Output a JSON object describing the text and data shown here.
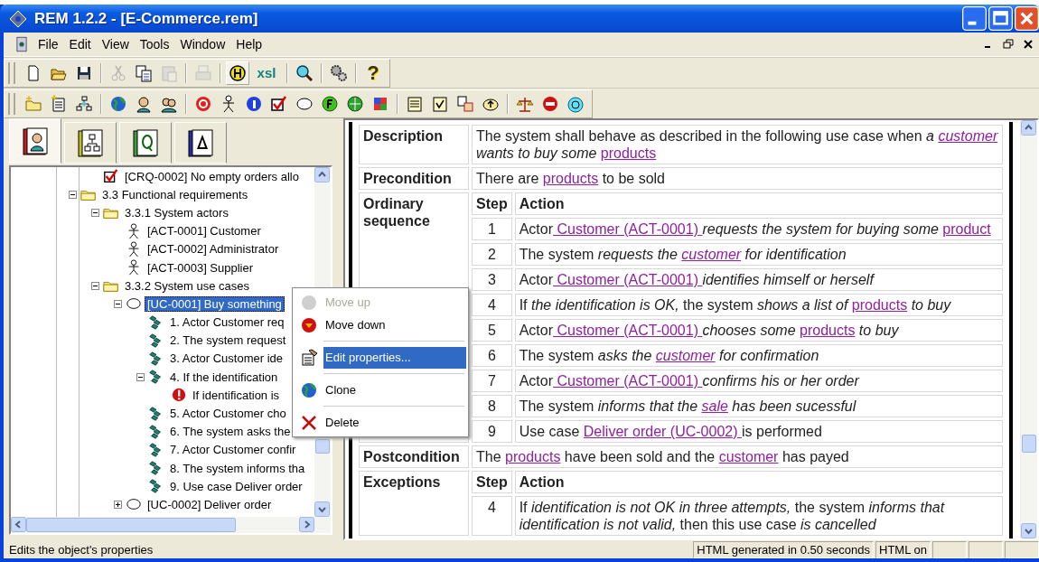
{
  "window": {
    "title": "REM 1.2.2 - [E-Commerce.rem]"
  },
  "menu": [
    "File",
    "Edit",
    "View",
    "Tools",
    "Window",
    "Help"
  ],
  "toolbars": [
    {
      "items": [
        {
          "kind": "new",
          "disabled": false
        },
        {
          "kind": "open",
          "disabled": false
        },
        {
          "kind": "save",
          "disabled": false
        },
        {
          "kind": "separator"
        },
        {
          "kind": "cut",
          "disabled": true
        },
        {
          "kind": "copy",
          "disabled": false
        },
        {
          "kind": "paste",
          "disabled": true
        },
        {
          "kind": "separator"
        },
        {
          "kind": "print",
          "disabled": true
        },
        {
          "kind": "separator"
        },
        {
          "kind": "html",
          "disabled": false
        },
        {
          "kind": "text",
          "label": "xsl",
          "disabled": false
        },
        {
          "kind": "separator"
        },
        {
          "kind": "zoom",
          "disabled": false
        },
        {
          "kind": "separator"
        },
        {
          "kind": "gears",
          "disabled": false
        },
        {
          "kind": "separator"
        },
        {
          "kind": "help",
          "label": "?",
          "disabled": false
        }
      ]
    },
    {
      "items": [
        {
          "kind": "new-folder"
        },
        {
          "kind": "new-doc"
        },
        {
          "kind": "diagram"
        },
        {
          "kind": "separator"
        },
        {
          "kind": "globe"
        },
        {
          "kind": "person"
        },
        {
          "kind": "people"
        },
        {
          "kind": "separator"
        },
        {
          "kind": "target"
        },
        {
          "kind": "actor"
        },
        {
          "kind": "info"
        },
        {
          "kind": "check"
        },
        {
          "kind": "ellipse"
        },
        {
          "kind": "green-ball"
        },
        {
          "kind": "green-globe"
        },
        {
          "kind": "grid"
        },
        {
          "kind": "separator"
        },
        {
          "kind": "note"
        },
        {
          "kind": "note-check"
        },
        {
          "kind": "docs"
        },
        {
          "kind": "oval-arrow"
        },
        {
          "kind": "separator"
        },
        {
          "kind": "scales"
        },
        {
          "kind": "stop"
        },
        {
          "kind": "cyan-ball"
        }
      ]
    }
  ],
  "tabs": [
    {
      "kind": "people-book",
      "selected": true
    },
    {
      "kind": "diagram-book",
      "selected": false
    },
    {
      "kind": "q-book",
      "selected": false
    },
    {
      "kind": "delta-book",
      "selected": false
    }
  ],
  "tree": {
    "items": [
      {
        "children": [
          {
            "label": "[CRQ-0002] No empty orders allo",
            "kind": "check",
            "selected": false
          }
        ]
      },
      {
        "label": "3.3 Functional requirements",
        "kind": "folder",
        "expanded": true,
        "selected": false,
        "children": [
          {
            "label": "3.3.1 System actors",
            "kind": "folder",
            "expanded": true,
            "selected": false,
            "children": [
              {
                "label": "[ACT-0001] Customer",
                "kind": "actor",
                "selected": false
              },
              {
                "label": "[ACT-0002] Administrator",
                "kind": "actor",
                "selected": false
              },
              {
                "label": "[ACT-0003] Supplier",
                "kind": "actor",
                "selected": false
              }
            ]
          },
          {
            "label": "3.3.2 System use cases",
            "kind": "folder",
            "expanded": true,
            "selected": false,
            "children": [
              {
                "label": "[UC-0001] Buy something",
                "kind": "ellipse",
                "expanded": true,
                "selected": true,
                "children": [
                  {
                    "label": "1. Actor Customer req",
                    "kind": "step",
                    "selected": false
                  },
                  {
                    "label": "2. The system request",
                    "kind": "step",
                    "selected": false
                  },
                  {
                    "label": "3. Actor Customer ide",
                    "kind": "step",
                    "selected": false
                  },
                  {
                    "label": "4. If the identification",
                    "kind": "step",
                    "expanded": true,
                    "selected": false,
                    "children": [
                      {
                        "label": "If identification is",
                        "kind": "error",
                        "selected": false
                      }
                    ]
                  },
                  {
                    "label": "5. Actor Customer cho",
                    "kind": "step",
                    "selected": false
                  },
                  {
                    "label": "6. The system asks the",
                    "kind": "step",
                    "selected": false
                  },
                  {
                    "label": "7. Actor Customer confir",
                    "kind": "step",
                    "selected": false
                  },
                  {
                    "label": "8. The system informs tha",
                    "kind": "step",
                    "selected": false
                  },
                  {
                    "label": "9. Use case Deliver order",
                    "kind": "step",
                    "selected": false
                  }
                ]
              },
              {
                "label": "[UC-0002] Deliver order",
                "kind": "ellipse",
                "expanded": false,
                "selected": false
              }
            ]
          }
        ]
      }
    ]
  },
  "context_menu": [
    {
      "kind": "grey-ball",
      "label": "Move up",
      "disabled": true,
      "selected": false
    },
    {
      "kind": "down-ball",
      "label": "Move down",
      "disabled": false,
      "selected": false
    },
    {
      "kind": "separator"
    },
    {
      "kind": "properties",
      "label": "Edit properties...",
      "disabled": false,
      "selected": true
    },
    {
      "kind": "separator"
    },
    {
      "kind": "globe",
      "label": "Clone",
      "disabled": false,
      "selected": false
    },
    {
      "kind": "separator"
    },
    {
      "kind": "delete",
      "label": "Delete",
      "disabled": false,
      "selected": false
    }
  ],
  "content": {
    "sections": [
      {
        "kind": "text",
        "heading": "Description",
        "text": [
          {
            "text": "The system shall behave as described in the following use case when ",
            "kind": "plain"
          },
          {
            "text": "a ",
            "kind": "italic"
          },
          {
            "text": "customer",
            "kind": "italic-link"
          },
          {
            "text": " wants to buy some ",
            "kind": "italic"
          },
          {
            "text": "products",
            "kind": "link"
          }
        ]
      },
      {
        "kind": "text",
        "heading": "Precondition",
        "text": [
          {
            "text": "There are ",
            "kind": "plain"
          },
          {
            "text": "products",
            "kind": "link"
          },
          {
            "text": " to be sold",
            "kind": "plain"
          }
        ]
      },
      {
        "kind": "steps",
        "heading": "Ordinary sequence",
        "columns": [
          "Step",
          "Action"
        ],
        "steps": [
          {
            "step": "1",
            "action": [
              {
                "text": "Actor",
                "kind": "plain"
              },
              {
                "text": " Customer (ACT-0001) ",
                "kind": "link"
              },
              {
                "text": "requests the system for buying some ",
                "kind": "italic"
              },
              {
                "text": "product",
                "kind": "link"
              }
            ]
          },
          {
            "step": "2",
            "action": [
              {
                "text": "The system ",
                "kind": "plain"
              },
              {
                "text": "requests the ",
                "kind": "italic"
              },
              {
                "text": "customer",
                "kind": "italic-link"
              },
              {
                "text": " for identification",
                "kind": "italic"
              }
            ]
          },
          {
            "step": "3",
            "action": [
              {
                "text": "Actor",
                "kind": "plain"
              },
              {
                "text": " Customer (ACT-0001) ",
                "kind": "link"
              },
              {
                "text": "identifies himself or herself",
                "kind": "italic"
              }
            ]
          },
          {
            "step": "4",
            "action": [
              {
                "text": "If ",
                "kind": "plain"
              },
              {
                "text": "the identification is OK,",
                "kind": "italic"
              },
              {
                "text": " the system ",
                "kind": "plain"
              },
              {
                "text": "shows a list of ",
                "kind": "italic"
              },
              {
                "text": "products",
                "kind": "link"
              },
              {
                "text": " to buy",
                "kind": "italic"
              }
            ]
          },
          {
            "step": "5",
            "action": [
              {
                "text": "Actor",
                "kind": "plain"
              },
              {
                "text": " Customer (ACT-0001) ",
                "kind": "link"
              },
              {
                "text": "chooses some ",
                "kind": "italic"
              },
              {
                "text": "products",
                "kind": "link"
              },
              {
                "text": " to buy",
                "kind": "italic"
              }
            ]
          },
          {
            "step": "6",
            "action": [
              {
                "text": "The system ",
                "kind": "plain"
              },
              {
                "text": "asks the ",
                "kind": "italic"
              },
              {
                "text": "customer",
                "kind": "italic-link"
              },
              {
                "text": " for confirmation",
                "kind": "italic"
              }
            ]
          },
          {
            "step": "7",
            "action": [
              {
                "text": "Actor",
                "kind": "plain"
              },
              {
                "text": " Customer (ACT-0001) ",
                "kind": "link"
              },
              {
                "text": "confirms his or her order",
                "kind": "italic"
              }
            ]
          },
          {
            "step": "8",
            "action": [
              {
                "text": "The system ",
                "kind": "plain"
              },
              {
                "text": "informs that the ",
                "kind": "italic"
              },
              {
                "text": "sale",
                "kind": "italic-link"
              },
              {
                "text": " has been sucessful",
                "kind": "italic"
              }
            ]
          },
          {
            "step": "9",
            "action": [
              {
                "text": "Use case ",
                "kind": "plain"
              },
              {
                "text": "Deliver order (UC-0002) ",
                "kind": "link"
              },
              {
                "text": "is performed",
                "kind": "plain"
              }
            ]
          }
        ]
      },
      {
        "kind": "text",
        "heading": "Postcondition",
        "text": [
          {
            "text": "The ",
            "kind": "plain"
          },
          {
            "text": "products",
            "kind": "link"
          },
          {
            "text": " have been sold and the ",
            "kind": "plain"
          },
          {
            "text": "customer",
            "kind": "link"
          },
          {
            "text": " has payed",
            "kind": "plain"
          }
        ]
      },
      {
        "kind": "steps",
        "heading": "Exceptions",
        "columns": [
          "Step",
          "Action"
        ],
        "steps": [
          {
            "step": "4",
            "action": [
              {
                "text": "If ",
                "kind": "plain"
              },
              {
                "text": "identification is not OK in three attempts,",
                "kind": "italic"
              },
              {
                "text": " the system ",
                "kind": "plain"
              },
              {
                "text": "informs that identification is not valid,",
                "kind": "italic"
              },
              {
                "text": " then this use case ",
                "kind": "plain"
              },
              {
                "text": "is cancelled",
                "kind": "italic"
              }
            ]
          }
        ]
      }
    ]
  },
  "status_bar": {
    "text": "Edits the object's properties",
    "panels": [
      "HTML generated in 0.50 seconds",
      "HTML on"
    ]
  }
}
